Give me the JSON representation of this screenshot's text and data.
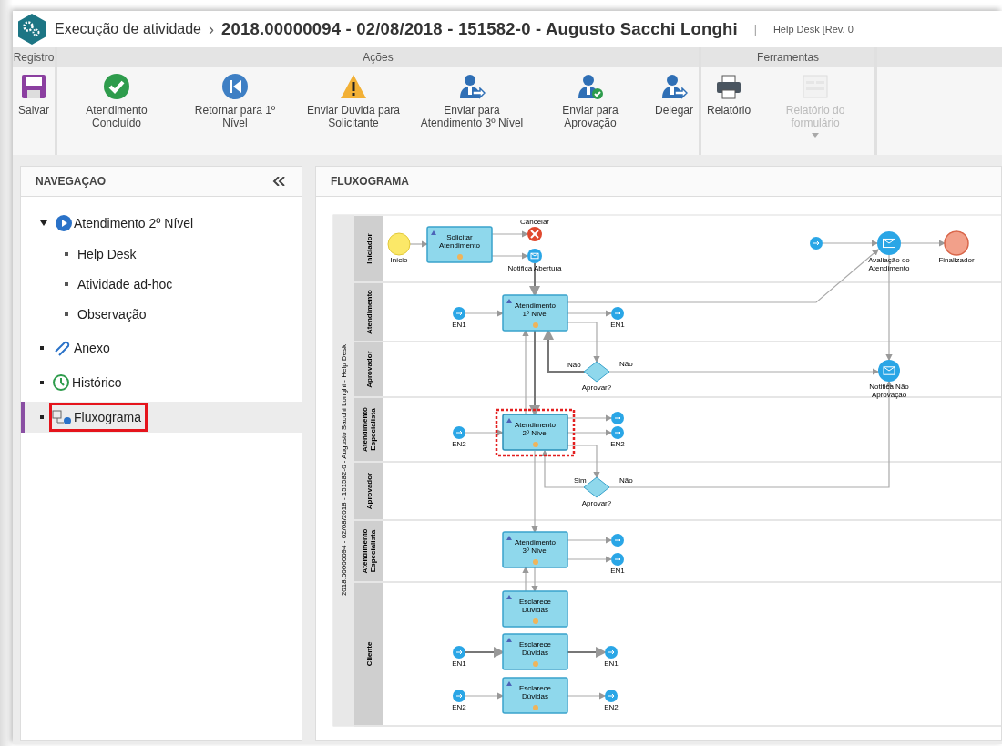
{
  "header": {
    "title": "Execução de atividade",
    "separator": "›",
    "record": "2018.00000094 - 02/08/2018 - 151582-0 - Augusto Sacchi Longhi",
    "divider": "|",
    "context": "Help Desk [Rev. 0"
  },
  "ribbon": [
    {
      "label": "Registro",
      "buttons": [
        {
          "kind": "save",
          "label": "Salvar",
          "disabled": false,
          "dropdown": false
        }
      ]
    },
    {
      "label": "Ações",
      "buttons": [
        {
          "kind": "check",
          "label": "Atendimento Concluído",
          "disabled": false,
          "dropdown": false
        },
        {
          "kind": "back",
          "label": "Retornar para 1º Nível",
          "disabled": false,
          "dropdown": false
        },
        {
          "kind": "warning",
          "label": "Enviar Duvida para Solicitante",
          "disabled": false,
          "dropdown": false
        },
        {
          "kind": "person-send",
          "label": "Enviar para Atendimento 3º Nível",
          "disabled": false,
          "dropdown": false
        },
        {
          "kind": "person-check",
          "label": "Enviar para Aprovação",
          "disabled": false,
          "dropdown": false
        },
        {
          "kind": "person-delegate",
          "label": "Delegar",
          "disabled": false,
          "dropdown": false
        }
      ]
    },
    {
      "label": "Ferramentas",
      "buttons": [
        {
          "kind": "printer",
          "label": "Relatório",
          "disabled": false,
          "dropdown": false
        },
        {
          "kind": "form",
          "label": "Relatório do formulário",
          "disabled": true,
          "dropdown": true
        }
      ]
    }
  ],
  "navigation": {
    "title": "NAVEGAÇAO",
    "items": [
      {
        "kind": "play",
        "label": "Atendimento 2º Nível",
        "expanded": true,
        "selected": false,
        "highlighted": false,
        "children": [
          {
            "label": "Help Desk"
          },
          {
            "label": "Atividade ad-hoc"
          },
          {
            "label": "Observação"
          }
        ]
      },
      {
        "kind": "clip",
        "label": "Anexo",
        "expanded": false,
        "selected": false,
        "highlighted": false
      },
      {
        "kind": "history",
        "label": "Histórico",
        "expanded": false,
        "selected": false,
        "highlighted": false
      },
      {
        "kind": "flow",
        "label": "Fluxograma",
        "expanded": false,
        "selected": true,
        "highlighted": true
      }
    ]
  },
  "flowchart": {
    "title": "FLUXOGRAMA",
    "pool": "2018.00000094 - 02/08/2018 - 151582-0 - Augusto Sacchi Longhi - Help Desk",
    "lanes": [
      "Iniciador",
      "Atendimento",
      "Aprovador",
      "Atendimento Especialista",
      "Aprovador",
      "Atendimento Especialista",
      "Cliente"
    ],
    "nodes": [
      {
        "kind": "start",
        "label": "Início"
      },
      {
        "kind": "task",
        "label": "Solicitar Atendimento",
        "selected": false
      },
      {
        "kind": "cancel",
        "label": "Cancelar"
      },
      {
        "kind": "message",
        "label": "Notifica Abertura"
      },
      {
        "kind": "link",
        "label": "EN1"
      },
      {
        "kind": "task",
        "label": "Atendimento 1º Nível",
        "selected": false
      },
      {
        "kind": "link",
        "label": "EN1"
      },
      {
        "kind": "gateway",
        "label": "Aprovar?"
      },
      {
        "kind": "message",
        "label": "Notifica Não Aprovação"
      },
      {
        "kind": "link",
        "label": "EN2"
      },
      {
        "kind": "task",
        "label": "Atendimento 2º Nível",
        "selected": true
      },
      {
        "kind": "link"
      },
      {
        "kind": "link",
        "label": "EN2"
      },
      {
        "kind": "gateway",
        "label": "Aprovar?"
      },
      {
        "kind": "task",
        "label": "Atendimento 3º Nível",
        "selected": false
      },
      {
        "kind": "link"
      },
      {
        "kind": "link",
        "label": "EN1"
      },
      {
        "kind": "task",
        "label": "Esclarece Dúvidas",
        "selected": false
      },
      {
        "kind": "link",
        "label": "EN1"
      },
      {
        "kind": "task",
        "label": "Esclarece Dúvidas",
        "selected": false
      },
      {
        "kind": "link",
        "label": "EN1"
      },
      {
        "kind": "link",
        "label": "EN2"
      },
      {
        "kind": "task",
        "label": "Esclarece Dúvidas",
        "selected": false
      },
      {
        "kind": "link",
        "label": "EN2"
      },
      {
        "kind": "link"
      },
      {
        "kind": "message",
        "label": "Avaliação do Atendimento"
      },
      {
        "kind": "end",
        "label": "Finalizador"
      }
    ],
    "edge_labels": [
      "Não",
      "Não",
      "Sim",
      "Não"
    ]
  }
}
